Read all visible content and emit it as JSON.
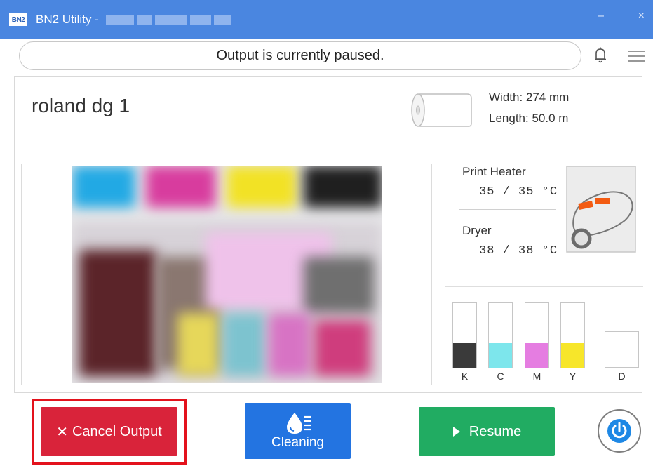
{
  "window": {
    "logo_text": "BN2",
    "title": "BN2 Utility -",
    "minimize_glyph": "–",
    "close_glyph": "×"
  },
  "status": {
    "message": "Output is currently paused.",
    "icons": [
      "bell-icon",
      "menu-icon"
    ]
  },
  "printer": {
    "name": "roland dg 1",
    "media_width": "Width: 274 mm",
    "media_length": "Length: 50.0 m"
  },
  "heaters": [
    {
      "label": "Print Heater",
      "value": "35 / 35 °C"
    },
    {
      "label": "Dryer",
      "value": "38 / 38 °C"
    }
  ],
  "inks": [
    {
      "label": "K",
      "color": "#3a3a3a",
      "level": 0.38
    },
    {
      "label": "C",
      "color": "#7de6ec",
      "level": 0.38
    },
    {
      "label": "M",
      "color": "#e57de1",
      "level": 0.38
    },
    {
      "label": "Y",
      "color": "#f7e62a",
      "level": 0.38
    },
    {
      "label": "D",
      "color": "#ffffff",
      "level": 0
    }
  ],
  "buttons": {
    "cancel": "Cancel Output",
    "cancel_glyph": "✕",
    "cleaning": "Cleaning",
    "resume": "Resume",
    "power_icon": "power-icon"
  },
  "colors": {
    "titlebar": "#4a86e0",
    "cancel": "#d9233a",
    "cleaning": "#2374e1",
    "resume": "#21ac62",
    "highlight_frame": "#e3121c",
    "power": "#1e88e5"
  }
}
